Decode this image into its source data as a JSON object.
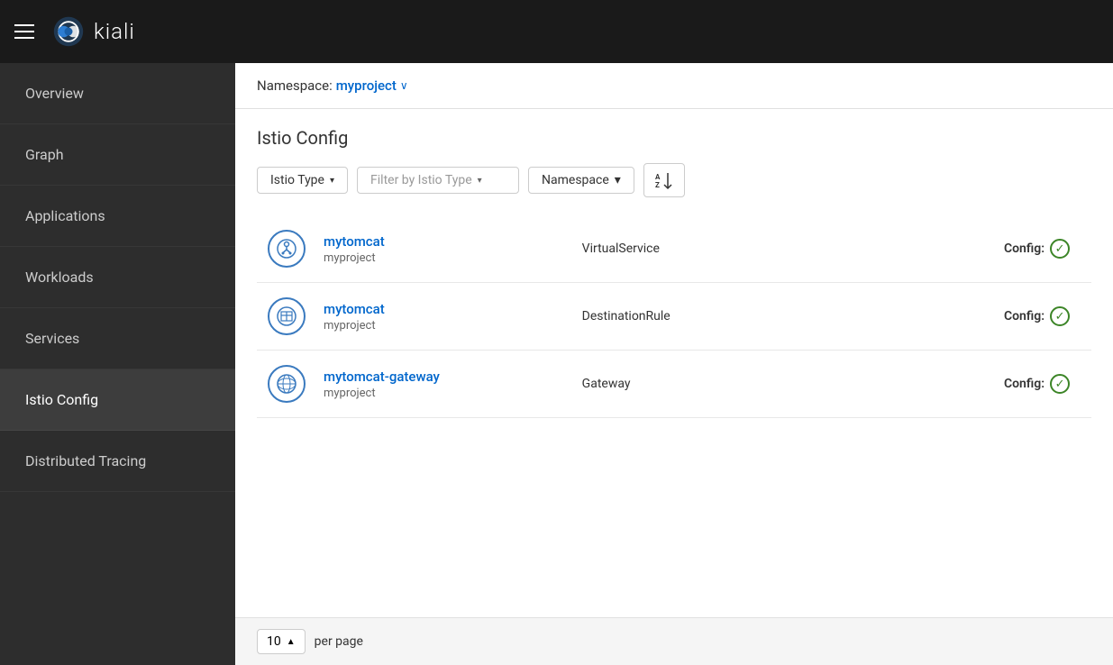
{
  "topbar": {
    "logo_text": "kiali",
    "hamburger_label": "Menu"
  },
  "sidebar": {
    "items": [
      {
        "id": "overview",
        "label": "Overview",
        "active": false
      },
      {
        "id": "graph",
        "label": "Graph",
        "active": false
      },
      {
        "id": "applications",
        "label": "Applications",
        "active": false
      },
      {
        "id": "workloads",
        "label": "Workloads",
        "active": false
      },
      {
        "id": "services",
        "label": "Services",
        "active": false
      },
      {
        "id": "istio-config",
        "label": "Istio Config",
        "active": true
      },
      {
        "id": "distributed-tracing",
        "label": "Distributed Tracing",
        "active": false
      }
    ]
  },
  "namespace_bar": {
    "label": "Namespace:",
    "value": "myproject"
  },
  "page": {
    "title": "Istio Config",
    "filters": {
      "istio_type_label": "Istio Type",
      "filter_by_type_placeholder": "Filter by Istio Type",
      "namespace_label": "Namespace",
      "sort_icon": "A↕Z"
    },
    "per_page": {
      "value": "10",
      "label": "per page"
    },
    "rows": [
      {
        "id": "mytomcat-vs",
        "icon_type": "virtual-service",
        "name": "mytomcat",
        "namespace": "myproject",
        "type": "VirtualService",
        "config_label": "Config:",
        "config_ok": true
      },
      {
        "id": "mytomcat-dr",
        "icon_type": "destination-rule",
        "name": "mytomcat",
        "namespace": "myproject",
        "type": "DestinationRule",
        "config_label": "Config:",
        "config_ok": true
      },
      {
        "id": "mytomcat-gateway",
        "icon_type": "gateway",
        "name": "mytomcat-gateway",
        "namespace": "myproject",
        "type": "Gateway",
        "config_label": "Config:",
        "config_ok": true
      }
    ]
  }
}
